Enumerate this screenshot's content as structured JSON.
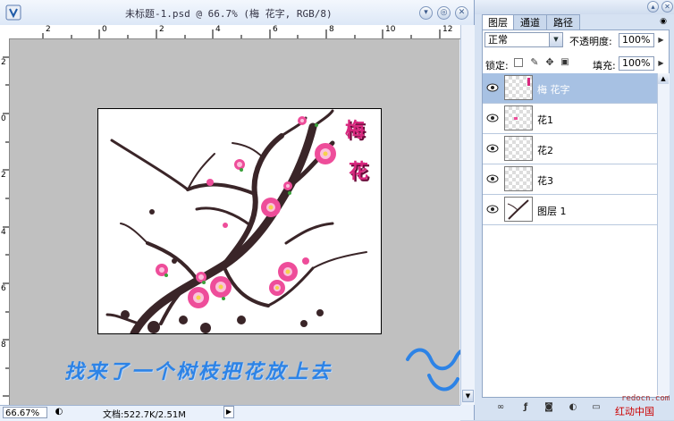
{
  "document": {
    "title": "未标题-1.psd @ 66.7% (梅 花字, RGB/8)",
    "ruler_h_ticks": [
      "2",
      "0",
      "2",
      "4",
      "6",
      "8",
      "10",
      "12"
    ],
    "ruler_v_ticks": [
      "2",
      "0",
      "2",
      "4",
      "6",
      "8"
    ],
    "zoom": "66.67%",
    "doc_info": "文档:522.7K/2.51M",
    "artwork_text": [
      "梅",
      "花"
    ],
    "caption": "找来了一个树枝把花放上去"
  },
  "panel": {
    "tabs": [
      {
        "label": "图层",
        "active": true
      },
      {
        "label": "通道",
        "active": false
      },
      {
        "label": "路径",
        "active": false
      }
    ],
    "blend_mode": "正常",
    "opacity_label": "不透明度:",
    "opacity_value": "100%",
    "lock_label": "锁定:",
    "fill_label": "填充:",
    "fill_value": "100%",
    "layers": [
      {
        "name": "梅 花字",
        "selected": true
      },
      {
        "name": "花1",
        "selected": false
      },
      {
        "name": "花2",
        "selected": false
      },
      {
        "name": "花3",
        "selected": false
      },
      {
        "name": "图层 1",
        "selected": false
      }
    ]
  },
  "watermark": {
    "line1": "redocn.com",
    "line2": "红动中国"
  },
  "colors": {
    "accent": "#2d83e6",
    "selection": "#a7c1e3",
    "blossom": "#ee4d9a",
    "branch": "#3a2528"
  }
}
